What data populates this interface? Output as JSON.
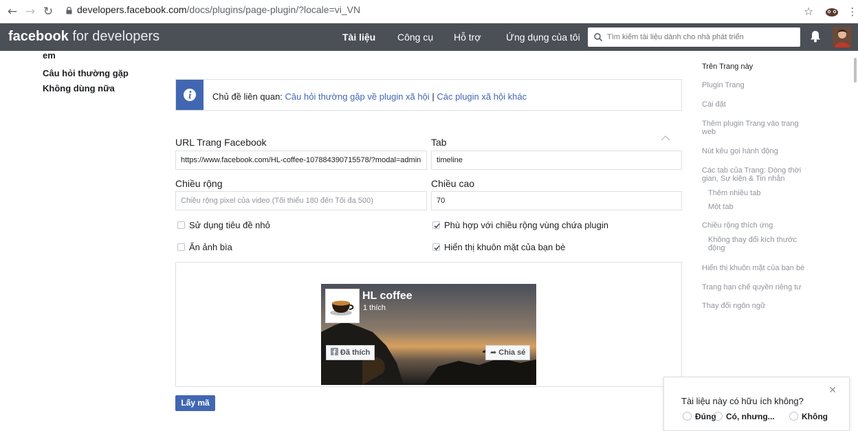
{
  "browser": {
    "url_host": "developers.facebook.com",
    "url_path": "/docs/plugins/page-plugin/?locale=vi_VN"
  },
  "header": {
    "brand_bold": "facebook",
    "brand_light": "for developers",
    "nav": [
      "Tài liệu",
      "Công cụ",
      "Hỗ trợ",
      "Ứng dụng của tôi"
    ],
    "search_placeholder": "Tìm kiếm tài liệu dành cho nhà phát triển"
  },
  "left_nav": {
    "partial": "em",
    "items": [
      "Câu hỏi thường gặp",
      "Không dùng nữa"
    ]
  },
  "info": {
    "prefix": "Chủ đề liên quan: ",
    "link1": "Câu hỏi thường gặp về plugin xã hội",
    "sep": " | ",
    "link2": "Các plugin xã hội khác"
  },
  "form": {
    "url_label": "URL Trang Facebook",
    "url_value": "https://www.facebook.com/HL-coffee-107884390715578/?modal=admin",
    "tab_label": "Tab",
    "tab_value": "timeline",
    "width_label": "Chiều rộng",
    "width_placeholder": "Chiều rộng pixel của video (Tối thiểu 180 đến Tối đa 500)",
    "height_label": "Chiều cao",
    "height_value": "70",
    "small_header": "Sử dụng tiêu đề nhỏ",
    "hide_cover": "Ẩn ảnh bìa",
    "adapt_width": "Phù hợp với chiều rộng vùng chứa plugin",
    "show_faces": "Hiển thị khuôn mặt của bạn bè",
    "checks": {
      "small_header": false,
      "hide_cover": false,
      "adapt_width": true,
      "show_faces": true
    },
    "get_code": "Lấy mã"
  },
  "preview": {
    "page_name": "HL coffee",
    "likes": "1 thích",
    "liked_btn": "Đã thích",
    "share_btn": "Chia sẻ"
  },
  "right_nav": {
    "items": [
      "Trên Trang này",
      "Plugin Trang",
      "Cài đặt",
      "Thêm plugin Trang vào trang",
      "web",
      "Nút kêu gọi hành động",
      "Các tab của Trang: Dòng thời",
      "gian, Sự kiện & Tin nhắn",
      "Thêm nhiều tab",
      "Một tab",
      "Chiều rộng thích ứng",
      "Không thay đổi kích thước",
      "động",
      "Hiển thị khuôn mặt của bạn bè",
      "Trang hạn chế quyền riêng tư",
      "Thay đổi ngôn ngữ"
    ]
  },
  "feedback": {
    "question": "Tài liệu này có hữu ích không?",
    "options": [
      "Đúng",
      "Có, nhưng...",
      "Không"
    ]
  }
}
